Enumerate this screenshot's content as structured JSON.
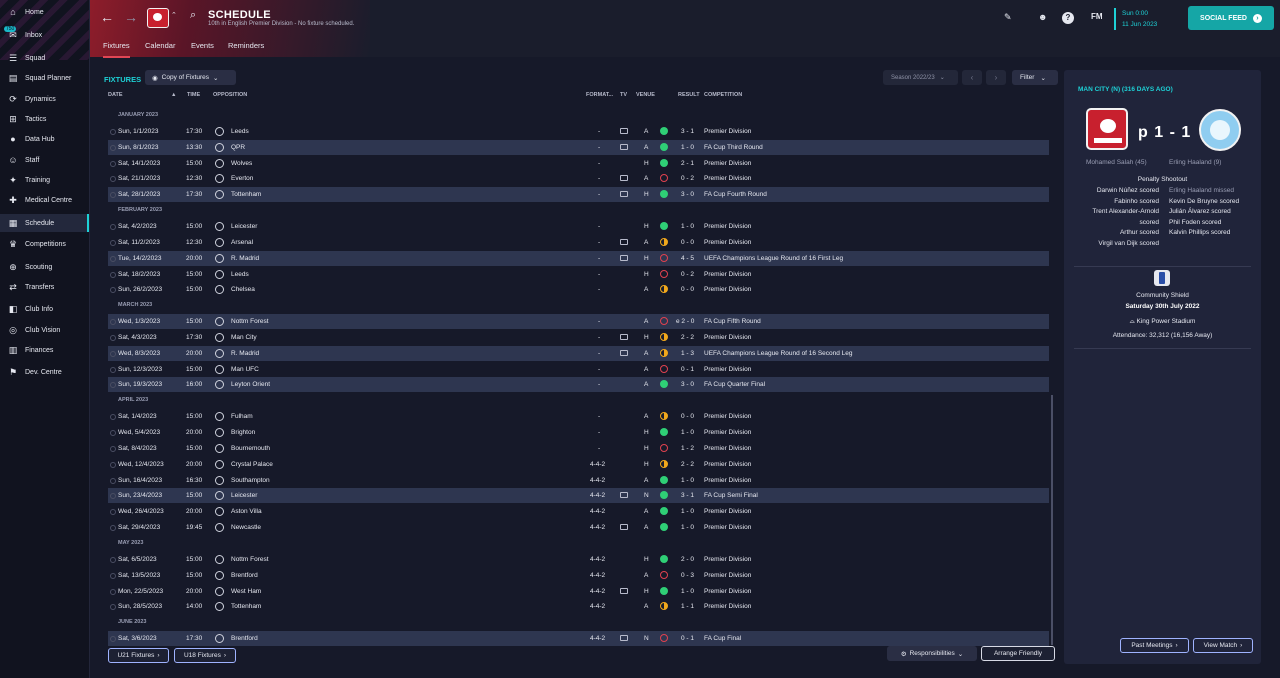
{
  "sidebar": {
    "inbox_count": "750",
    "items": [
      {
        "label": "Home",
        "icon": "home-icon"
      },
      {
        "label": "Inbox",
        "icon": "inbox-icon"
      },
      {
        "label": "Squad",
        "icon": "squad-icon"
      },
      {
        "label": "Squad Planner",
        "icon": "squad-planner-icon"
      },
      {
        "label": "Dynamics",
        "icon": "dynamics-icon"
      },
      {
        "label": "Tactics",
        "icon": "tactics-icon"
      },
      {
        "label": "Data Hub",
        "icon": "data-hub-icon"
      },
      {
        "label": "Staff",
        "icon": "staff-icon"
      },
      {
        "label": "Training",
        "icon": "training-icon"
      },
      {
        "label": "Medical Centre",
        "icon": "medical-icon"
      },
      {
        "label": "Schedule",
        "icon": "schedule-icon"
      },
      {
        "label": "Competitions",
        "icon": "trophy-icon"
      },
      {
        "label": "Scouting",
        "icon": "scouting-icon"
      },
      {
        "label": "Transfers",
        "icon": "transfers-icon"
      },
      {
        "label": "Club Info",
        "icon": "club-info-icon"
      },
      {
        "label": "Club Vision",
        "icon": "club-vision-icon"
      },
      {
        "label": "Finances",
        "icon": "finances-icon"
      },
      {
        "label": "Dev. Centre",
        "icon": "dev-centre-icon"
      }
    ]
  },
  "header": {
    "title": "SCHEDULE",
    "subtitle": "10th in English Premier Division - No fixture scheduled.",
    "tabs": [
      "Fixtures",
      "Calendar",
      "Events",
      "Reminders"
    ],
    "active_tab": "Fixtures",
    "time": "Sun 0:00",
    "date": "11 Jun 2023",
    "fm_label": "FM",
    "help_label": "?",
    "social_feed": "SOCIAL FEED"
  },
  "fixtures": {
    "title": "FIXTURES",
    "view_select": "Copy of Fixtures",
    "season_select": "Season 2022/23",
    "filter": "Filter",
    "columns": {
      "date": "DATE",
      "time": "TIME",
      "opposition": "OPPOSITION",
      "formation": "FORMAT...",
      "tv": "TV",
      "venue": "VENUE",
      "result": "RESULT",
      "competition": "COMPETITION"
    },
    "rows": [
      {
        "month": "JANUARY 2023"
      },
      {
        "date": "Sun, 1/1/2023",
        "time": "17:30",
        "opp": "Leeds",
        "form": "-",
        "tv": true,
        "venue": "A",
        "res": "W",
        "score": "3 - 1",
        "comp": "Premier Division",
        "hl": false
      },
      {
        "date": "Sun, 8/1/2023",
        "time": "13:30",
        "opp": "QPR",
        "form": "-",
        "tv": true,
        "venue": "A",
        "res": "W",
        "score": "1 - 0",
        "comp": "FA Cup Third Round",
        "hl": true
      },
      {
        "date": "Sat, 14/1/2023",
        "time": "15:00",
        "opp": "Wolves",
        "form": "-",
        "tv": false,
        "venue": "H",
        "res": "W",
        "score": "2 - 1",
        "comp": "Premier Division",
        "hl": false
      },
      {
        "date": "Sat, 21/1/2023",
        "time": "12:30",
        "opp": "Everton",
        "form": "-",
        "tv": true,
        "venue": "A",
        "res": "L",
        "score": "0 - 2",
        "comp": "Premier Division",
        "hl": false
      },
      {
        "date": "Sat, 28/1/2023",
        "time": "17:30",
        "opp": "Tottenham",
        "form": "-",
        "tv": true,
        "venue": "H",
        "res": "W",
        "score": "3 - 0",
        "comp": "FA Cup Fourth Round",
        "hl": true
      },
      {
        "month": "FEBRUARY 2023"
      },
      {
        "date": "Sat, 4/2/2023",
        "time": "15:00",
        "opp": "Leicester",
        "form": "-",
        "tv": false,
        "venue": "H",
        "res": "W",
        "score": "1 - 0",
        "comp": "Premier Division",
        "hl": false
      },
      {
        "date": "Sat, 11/2/2023",
        "time": "12:30",
        "opp": "Arsenal",
        "form": "-",
        "tv": true,
        "venue": "A",
        "res": "D",
        "score": "0 - 0",
        "comp": "Premier Division",
        "hl": false
      },
      {
        "date": "Tue, 14/2/2023",
        "time": "20:00",
        "opp": "R. Madrid",
        "form": "-",
        "tv": true,
        "venue": "H",
        "res": "L",
        "score": "4 - 5",
        "comp": "UEFA Champions League Round of 16  First Leg",
        "hl": true
      },
      {
        "date": "Sat, 18/2/2023",
        "time": "15:00",
        "opp": "Leeds",
        "form": "-",
        "tv": false,
        "venue": "H",
        "res": "L",
        "score": "0 - 2",
        "comp": "Premier Division",
        "hl": false
      },
      {
        "date": "Sun, 26/2/2023",
        "time": "15:00",
        "opp": "Chelsea",
        "form": "-",
        "tv": false,
        "venue": "A",
        "res": "D",
        "score": "0 - 0",
        "comp": "Premier Division",
        "hl": false
      },
      {
        "month": "MARCH 2023"
      },
      {
        "date": "Wed, 1/3/2023",
        "time": "15:00",
        "opp": "Nottm Forest",
        "form": "-",
        "tv": false,
        "venue": "A",
        "res": "L",
        "score": "e 2 - 0",
        "comp": "FA Cup Fifth Round",
        "hl": true
      },
      {
        "date": "Sat, 4/3/2023",
        "time": "17:30",
        "opp": "Man City",
        "form": "-",
        "tv": true,
        "venue": "H",
        "res": "D",
        "score": "2 - 2",
        "comp": "Premier Division",
        "hl": false
      },
      {
        "date": "Wed, 8/3/2023",
        "time": "20:00",
        "opp": "R. Madrid",
        "form": "-",
        "tv": true,
        "venue": "A",
        "res": "D",
        "score": "1 - 3",
        "comp": "UEFA Champions League Round of 16  Second Leg",
        "hl": true
      },
      {
        "date": "Sun, 12/3/2023",
        "time": "15:00",
        "opp": "Man UFC",
        "form": "-",
        "tv": false,
        "venue": "A",
        "res": "L",
        "score": "0 - 1",
        "comp": "Premier Division",
        "hl": false
      },
      {
        "date": "Sun, 19/3/2023",
        "time": "16:00",
        "opp": "Leyton Orient",
        "form": "-",
        "tv": false,
        "venue": "A",
        "res": "W",
        "score": "3 - 0",
        "comp": "FA Cup Quarter Final",
        "hl": true
      },
      {
        "month": "APRIL 2023"
      },
      {
        "date": "Sat, 1/4/2023",
        "time": "15:00",
        "opp": "Fulham",
        "form": "-",
        "tv": false,
        "venue": "A",
        "res": "D",
        "score": "0 - 0",
        "comp": "Premier Division",
        "hl": false
      },
      {
        "date": "Wed, 5/4/2023",
        "time": "20:00",
        "opp": "Brighton",
        "form": "-",
        "tv": false,
        "venue": "H",
        "res": "W",
        "score": "1 - 0",
        "comp": "Premier Division",
        "hl": false
      },
      {
        "date": "Sat, 8/4/2023",
        "time": "15:00",
        "opp": "Bournemouth",
        "form": "-",
        "tv": false,
        "venue": "H",
        "res": "L",
        "score": "1 - 2",
        "comp": "Premier Division",
        "hl": false
      },
      {
        "date": "Wed, 12/4/2023",
        "time": "20:00",
        "opp": "Crystal Palace",
        "form": "4-4-2",
        "tv": false,
        "venue": "H",
        "res": "D",
        "score": "2 - 2",
        "comp": "Premier Division",
        "hl": false
      },
      {
        "date": "Sun, 16/4/2023",
        "time": "16:30",
        "opp": "Southampton",
        "form": "4-4-2",
        "tv": false,
        "venue": "A",
        "res": "W",
        "score": "1 - 0",
        "comp": "Premier Division",
        "hl": false
      },
      {
        "date": "Sun, 23/4/2023",
        "time": "15:00",
        "opp": "Leicester",
        "form": "4-4-2",
        "tv": true,
        "venue": "N",
        "res": "W",
        "score": "3 - 1",
        "comp": "FA Cup Semi Final",
        "hl": true
      },
      {
        "date": "Wed, 26/4/2023",
        "time": "20:00",
        "opp": "Aston Villa",
        "form": "4-4-2",
        "tv": false,
        "venue": "A",
        "res": "W",
        "score": "1 - 0",
        "comp": "Premier Division",
        "hl": false
      },
      {
        "date": "Sat, 29/4/2023",
        "time": "19:45",
        "opp": "Newcastle",
        "form": "4-4-2",
        "tv": true,
        "venue": "A",
        "res": "W",
        "score": "1 - 0",
        "comp": "Premier Division",
        "hl": false
      },
      {
        "month": "MAY 2023"
      },
      {
        "date": "Sat, 6/5/2023",
        "time": "15:00",
        "opp": "Nottm Forest",
        "form": "4-4-2",
        "tv": false,
        "venue": "H",
        "res": "W",
        "score": "2 - 0",
        "comp": "Premier Division",
        "hl": false
      },
      {
        "date": "Sat, 13/5/2023",
        "time": "15:00",
        "opp": "Brentford",
        "form": "4-4-2",
        "tv": false,
        "venue": "A",
        "res": "L",
        "score": "0 - 3",
        "comp": "Premier Division",
        "hl": false
      },
      {
        "date": "Mon, 22/5/2023",
        "time": "20:00",
        "opp": "West Ham",
        "form": "4-4-2",
        "tv": true,
        "venue": "H",
        "res": "W",
        "score": "1 - 0",
        "comp": "Premier Division",
        "hl": false
      },
      {
        "date": "Sun, 28/5/2023",
        "time": "14:00",
        "opp": "Tottenham",
        "form": "4-4-2",
        "tv": false,
        "venue": "A",
        "res": "D",
        "score": "1 - 1",
        "comp": "Premier Division",
        "hl": false
      },
      {
        "month": "JUNE 2023"
      },
      {
        "date": "Sat, 3/6/2023",
        "time": "17:30",
        "opp": "Brentford",
        "form": "4-4-2",
        "tv": true,
        "venue": "N",
        "res": "L",
        "score": "0 - 1",
        "comp": "FA Cup Final",
        "hl": true
      }
    ],
    "buttons": {
      "u21": "U21 Fixtures",
      "u18": "U18 Fixtures",
      "responsibilities": "Responsibilities",
      "arrange": "Arrange Friendly"
    }
  },
  "match_panel": {
    "title": "MAN CITY (N) (316 DAYS AGO)",
    "score": "p 1 - 1",
    "home_scorer": "Mohamed Salah (45)",
    "away_scorer": "Erling Haaland (9)",
    "shootout_title": "Penalty Shootout",
    "home_pens": [
      "Darwin Núñez scored",
      "Fabinho scored",
      "Trent Alexander-Arnold",
      "scored",
      "Arthur scored",
      "Virgil van Dijk scored"
    ],
    "away_pens": [
      "Erling Haaland missed",
      "Kevin De Bruyne scored",
      "Julián Álvarez scored",
      "Phil Foden scored",
      "Kalvin Phillips scored"
    ],
    "competition": "Community Shield",
    "date": "Saturday 30th July 2022",
    "stadium": "King Power Stadium",
    "attendance": "Attendance: 32,312 (16,156 Away)",
    "past_meetings": "Past Meetings",
    "view_match": "View Match"
  },
  "colors": {
    "accent": "#1ed1d6",
    "win": "#2fcf76",
    "loss": "#e0414f",
    "draw": "#f1a81c",
    "highlight_row": "#2e3650"
  }
}
